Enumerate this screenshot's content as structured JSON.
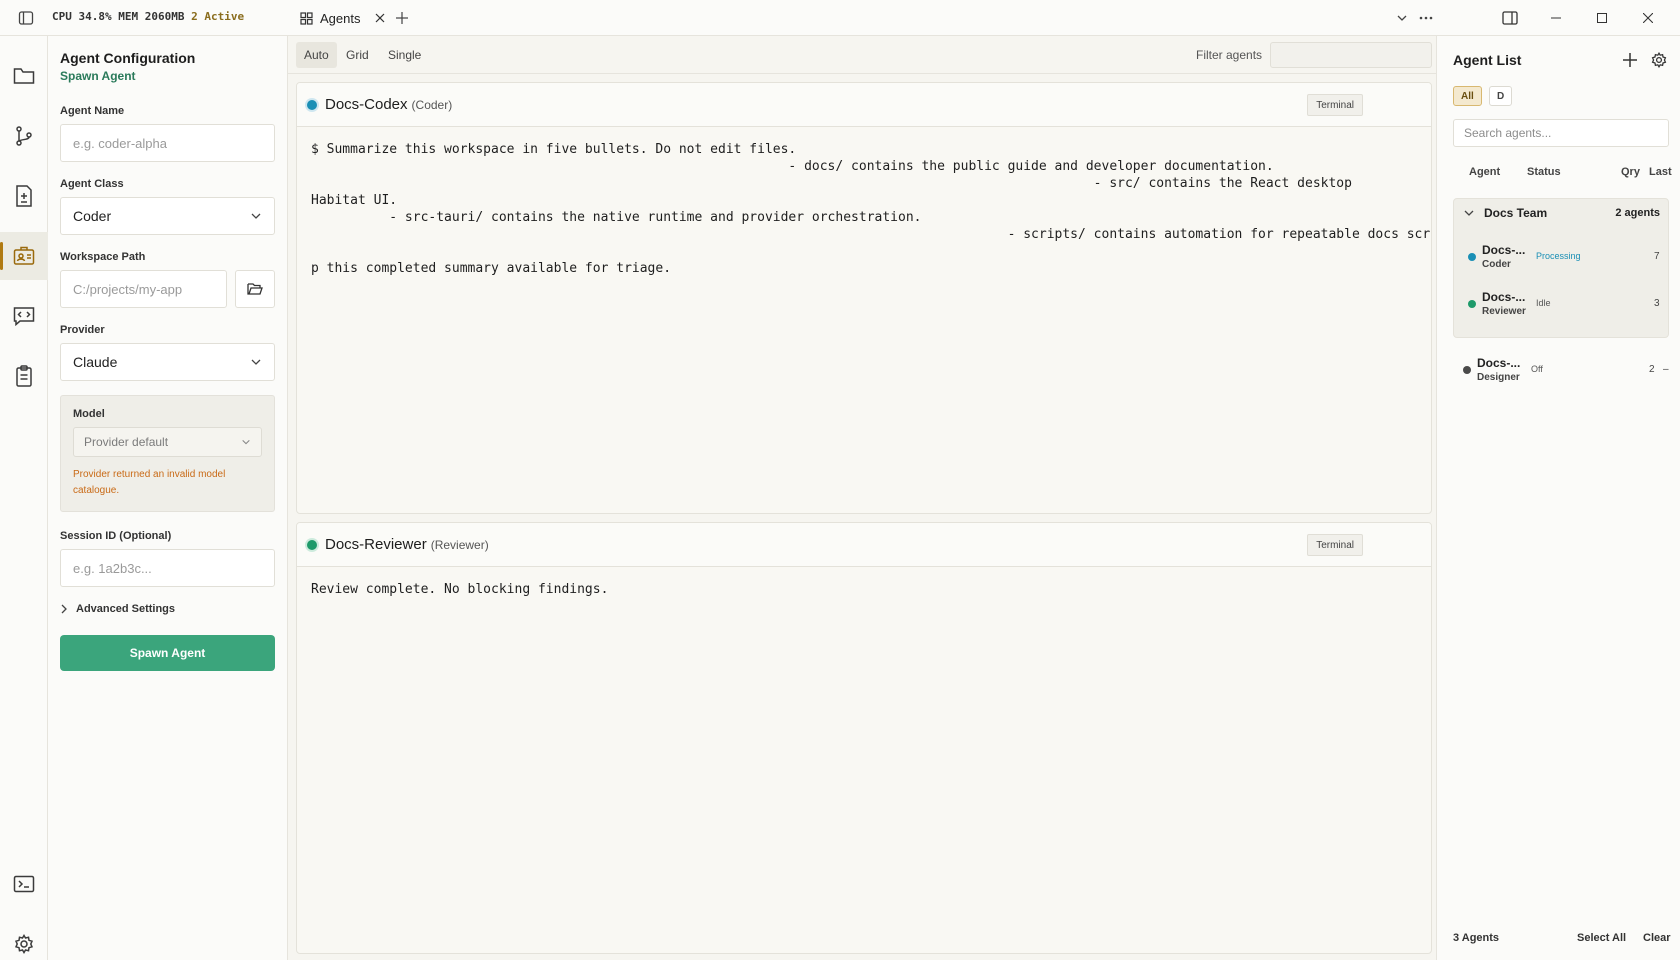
{
  "titlebar": {
    "cpu": "CPU 34.8%",
    "mem": "MEM 2060MB",
    "active": "2 Active",
    "tab_label": "Agents"
  },
  "config": {
    "title": "Agent Configuration",
    "subtitle": "Spawn Agent",
    "name_label": "Agent Name",
    "name_placeholder": "e.g. coder-alpha",
    "class_label": "Agent Class",
    "class_value": "Coder",
    "path_label": "Workspace Path",
    "path_placeholder": "C:/projects/my-app",
    "provider_label": "Provider",
    "provider_value": "Claude",
    "model_label": "Model",
    "model_value": "Provider default",
    "model_error": "Provider returned an invalid model catalogue.",
    "session_label": "Session ID (Optional)",
    "session_placeholder": "e.g. 1a2b3c...",
    "advanced_label": "Advanced Settings",
    "spawn_label": "Spawn Agent"
  },
  "toolbar": {
    "layout_auto": "Auto",
    "layout_grid": "Grid",
    "layout_single": "Single",
    "filter_label": "Filter agents"
  },
  "cards": [
    {
      "name": "Docs-Codex",
      "role": "(Coder)",
      "status_color": "#1a8fb5",
      "terminal_label": "Terminal",
      "output": "$ Summarize this workspace in five bullets. Do not edit files.\n                                                             - docs/ contains the public guide and developer documentation.\n                                                                                                    - src/ contains the React desktop\nHabitat UI.\n          - src-tauri/ contains the native runtime and provider orchestration.\n                                                                                         - scripts/ contains automation for repeatable docs screenshots.\n                                                                                                                                                                    - Queue will kee\np this completed summary available for triage."
    },
    {
      "name": "Docs-Reviewer",
      "role": "(Reviewer)",
      "status_color": "#1e9a6a",
      "terminal_label": "Terminal",
      "output": "Review complete. No blocking findings."
    }
  ],
  "right_panel": {
    "title": "Agent List",
    "chip_all": "All",
    "chip_d": "D",
    "search_placeholder": "Search agents...",
    "col_agent": "Agent",
    "col_status": "Status",
    "col_qry": "Qry",
    "col_last": "Last",
    "team_name": "Docs Team",
    "team_count": "2 agents",
    "team_agents": [
      {
        "name": "Docs-...",
        "role": "Coder",
        "status": "Processing",
        "qry": "7",
        "dot": "#1a8fb5",
        "status_color": "#1a8fb5"
      },
      {
        "name": "Docs-...",
        "role": "Reviewer",
        "status": "Idle",
        "qry": "3",
        "dot": "#1e9a6a",
        "status_color": "#555555"
      }
    ],
    "loose_agent": {
      "name": "Docs-...",
      "role": "Designer",
      "status": "Off",
      "qry": "2",
      "last": "–",
      "dot": "#4a4a4a"
    },
    "footer_count": "3 Agents",
    "select_all": "Select All",
    "clear": "Clear"
  }
}
